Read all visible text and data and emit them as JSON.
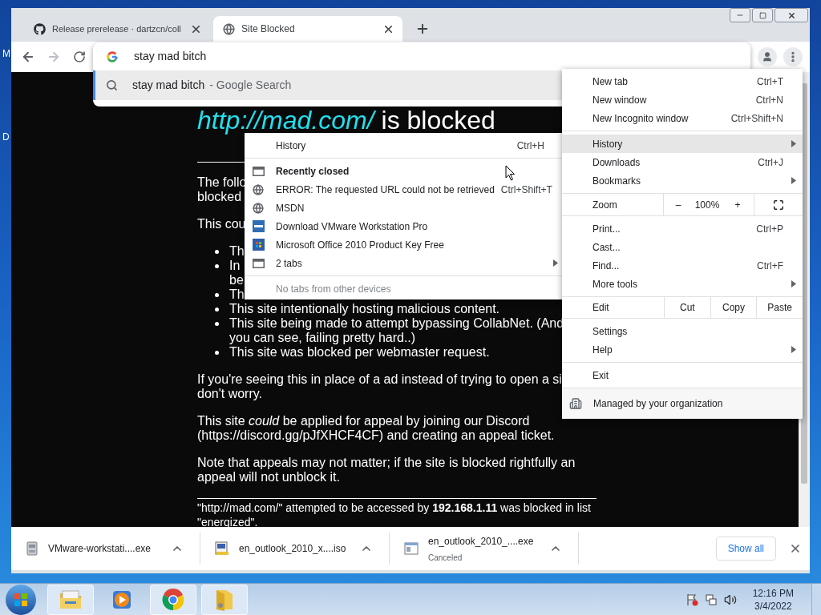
{
  "desktop": {
    "icon_labels": [
      "M",
      "D"
    ]
  },
  "browser": {
    "tabs": [
      {
        "title": "Release prerelease · dartzcn/coll",
        "kind": "github",
        "selected": false
      },
      {
        "title": "Site Blocked",
        "kind": "globe",
        "selected": true
      }
    ],
    "omnibox": {
      "value": "stay mad bitch",
      "suggestions": [
        {
          "query": "stay mad bitch",
          "suffix": "- Google Search",
          "selected": true
        }
      ]
    },
    "page": {
      "heading_link": "http://mad.com/",
      "heading_text": "is blocked",
      "blocks": [
        {
          "kind": "paragraph",
          "lines": [
            "The follo",
            "blocked"
          ]
        },
        {
          "kind": "paragraph",
          "lines": [
            "This cou"
          ]
        },
        {
          "kind": "list",
          "items": [
            {
              "lines": [
                "Th"
              ]
            },
            {
              "lines": [
                "In",
                "be"
              ]
            },
            {
              "lines": [
                "Th"
              ]
            },
            {
              "lines": [
                "This site intentionally hosting malicious content."
              ]
            },
            {
              "lines": [
                "This site being made to attempt bypassing CollabNet. (And",
                "you can see, failing pretty hard..)"
              ]
            },
            {
              "lines": [
                "This site was blocked per webmaster request."
              ]
            }
          ]
        },
        {
          "kind": "paragraph",
          "lines": [
            "If you're seeing this in place of a ad instead of trying to open a si",
            "don't worry."
          ]
        },
        {
          "kind": "paragraph",
          "lines": [
            "This site *could* be applied for appeal by joining our Discord",
            "(https://discord.gg/pJfXHCF4CF) and creating an appeal ticket."
          ]
        },
        {
          "kind": "paragraph",
          "lines": [
            "Note that appeals may not matter; if the site is blocked rightfully an",
            "appeal will not unblock it."
          ]
        },
        {
          "kind": "footer",
          "lines": [
            "\"http://mad.com/\" attempted to be accessed by **192.168.1.11** was blocked in list",
            "\"energized\"."
          ]
        }
      ]
    },
    "menu": {
      "groups": [
        [
          {
            "kind": "item",
            "label": "New tab",
            "shortcut": "Ctrl+T",
            "submenu": false,
            "selected": false
          },
          {
            "kind": "item",
            "label": "New window",
            "shortcut": "Ctrl+N",
            "submenu": false,
            "selected": false
          },
          {
            "kind": "item",
            "label": "New Incognito window",
            "shortcut": "Ctrl+Shift+N",
            "submenu": false,
            "selected": false
          }
        ],
        [
          {
            "kind": "item",
            "label": "History",
            "submenu": true,
            "selected": true
          },
          {
            "kind": "item",
            "label": "Downloads",
            "shortcut": "Ctrl+J",
            "submenu": false,
            "selected": false
          },
          {
            "kind": "item",
            "label": "Bookmarks",
            "submenu": true,
            "selected": false
          }
        ],
        [
          {
            "kind": "zoom",
            "label": "Zoom",
            "minus": "–",
            "value": "100%",
            "plus": "+",
            "selected": false
          }
        ],
        [
          {
            "kind": "item",
            "label": "Print...",
            "shortcut": "Ctrl+P",
            "submenu": false,
            "selected": false
          },
          {
            "kind": "item",
            "label": "Cast...",
            "submenu": false,
            "selected": false
          },
          {
            "kind": "item",
            "label": "Find...",
            "shortcut": "Ctrl+F",
            "submenu": false,
            "selected": false
          },
          {
            "kind": "item",
            "label": "More tools",
            "submenu": true,
            "selected": false
          }
        ],
        [
          {
            "kind": "edit",
            "label": "Edit",
            "actions": [
              "Cut",
              "Copy",
              "Paste"
            ],
            "selected": false
          }
        ],
        [
          {
            "kind": "item",
            "label": "Settings",
            "submenu": false,
            "selected": false
          },
          {
            "kind": "item",
            "label": "Help",
            "submenu": true,
            "selected": false
          }
        ],
        [
          {
            "kind": "item",
            "label": "Exit",
            "submenu": false,
            "selected": false
          }
        ],
        [
          {
            "kind": "managed",
            "label": "Managed by your organization",
            "selected": false
          }
        ]
      ]
    },
    "history_menu": {
      "groups": [
        [
          {
            "kind": "plain",
            "label": "History",
            "shortcut": "Ctrl+H",
            "submenu": false,
            "selected": false
          }
        ],
        [
          {
            "kind": "header",
            "label": "Recently closed",
            "submenu": false,
            "selected": false
          },
          {
            "kind": "globe",
            "label": "ERROR: The requested URL could not be retrieved",
            "shortcut": "Ctrl+Shift+T",
            "submenu": false,
            "selected": false
          },
          {
            "kind": "globe",
            "label": "MSDN",
            "submenu": false,
            "selected": false
          },
          {
            "kind": "vmware",
            "label": "Download VMware Workstation Pro",
            "submenu": false,
            "selected": false
          },
          {
            "kind": "office",
            "label": "Microsoft Office 2010 Product Key Free",
            "submenu": false,
            "selected": false
          },
          {
            "kind": "tabs",
            "label": "2 tabs",
            "submenu": true,
            "selected": false
          }
        ],
        [
          {
            "kind": "note",
            "label": "No tabs from other devices",
            "submenu": false,
            "selected": false
          }
        ]
      ]
    },
    "downloads": {
      "items": [
        {
          "name": "VMware-workstati....exe",
          "kind": "installer"
        },
        {
          "name": "en_outlook_2010_x....iso",
          "kind": "disc"
        },
        {
          "name": "en_outlook_2010_....exe",
          "status": "Canceled",
          "kind": "program"
        }
      ],
      "show_all": "Show all"
    }
  },
  "taskbar": {
    "apps": [
      {
        "kind": "explorer",
        "running": true
      },
      {
        "kind": "media",
        "running": false
      },
      {
        "kind": "chrome",
        "running": true
      },
      {
        "kind": "folder",
        "running": true
      }
    ],
    "time": "12:16 PM",
    "date": "3/4/2022"
  }
}
